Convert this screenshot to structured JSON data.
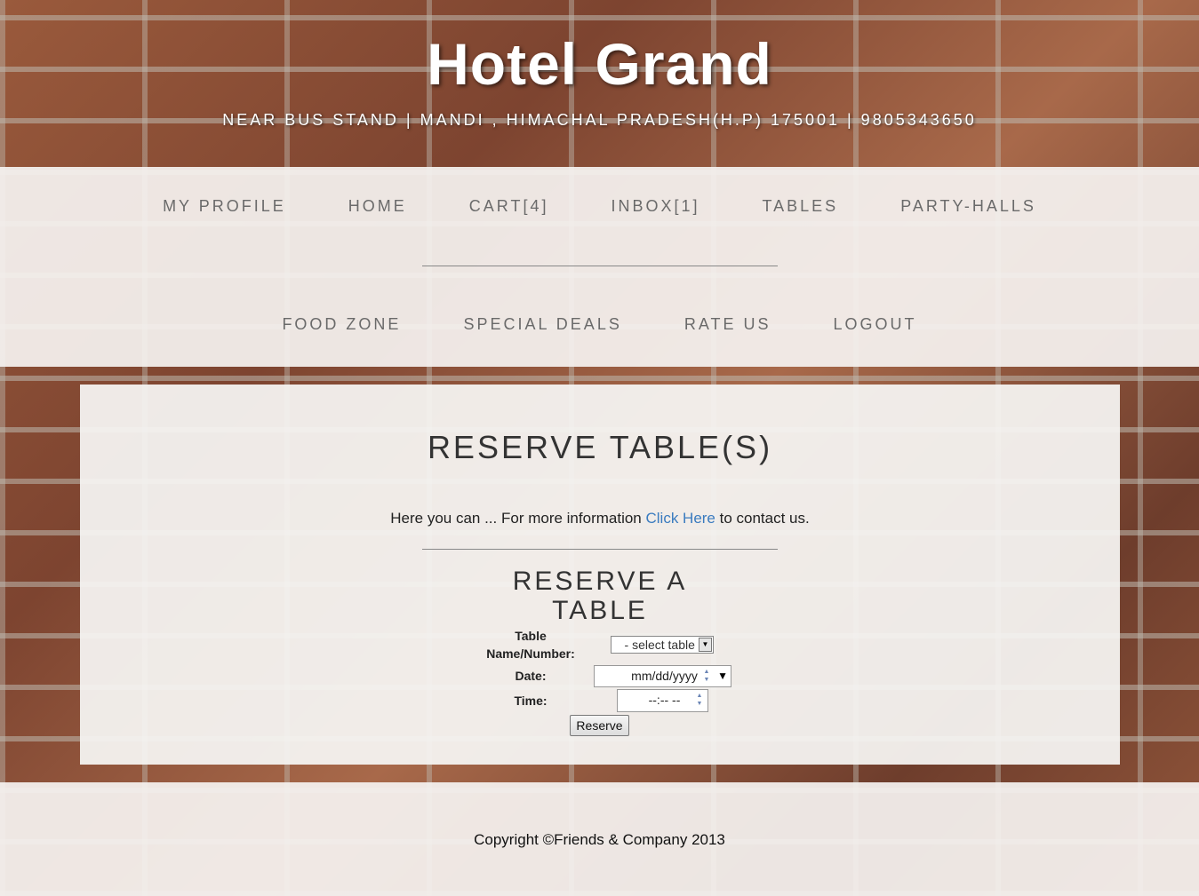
{
  "header": {
    "title": "Hotel Grand",
    "address": "NEAR BUS STAND | MANDI , HIMACHAL PRADESH(H.P) 175001 | 9805343650"
  },
  "nav": {
    "row1": [
      "MY PROFILE",
      "HOME",
      "CART[4]",
      "INBOX[1]",
      "TABLES",
      "PARTY-HALLS"
    ],
    "row2": [
      "FOOD ZONE",
      "SPECIAL DEALS",
      "RATE US",
      "LOGOUT"
    ]
  },
  "main": {
    "title": "RESERVE TABLE(S)",
    "intro_before": "Here you can ... For more information ",
    "intro_link": "Click Here",
    "intro_after": " to contact us.",
    "form": {
      "title": "RESERVE A TABLE",
      "table_label": "Table Name/Number:",
      "table_value": "- select table -",
      "date_label": "Date:",
      "date_placeholder": "mm/dd/yyyy",
      "time_label": "Time:",
      "time_placeholder": "--:-- --",
      "submit_label": "Reserve"
    }
  },
  "footer": {
    "copyright": "Copyright ©Friends & Company 2013"
  }
}
